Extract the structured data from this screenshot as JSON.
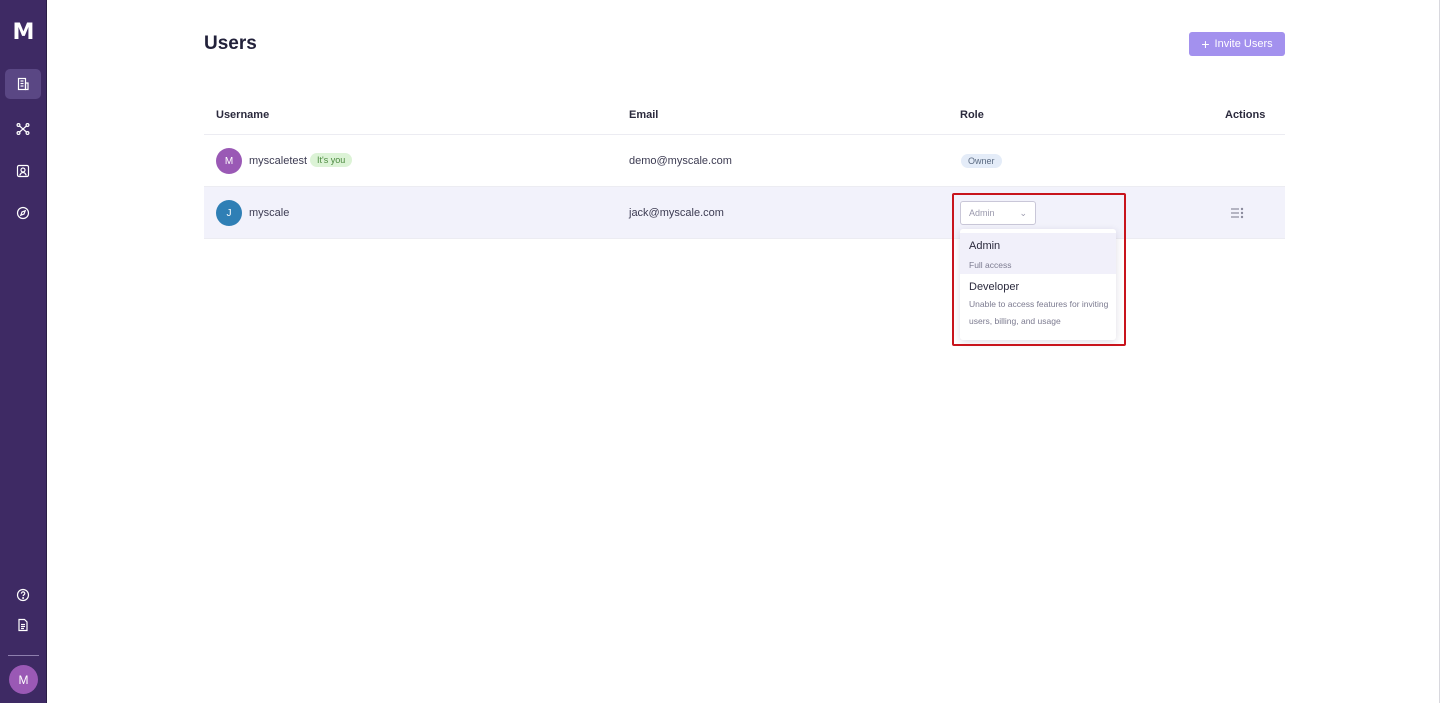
{
  "app": {
    "logo_text": "M"
  },
  "sidebar": {
    "nav": [
      {
        "icon": "building-icon",
        "active": true
      },
      {
        "icon": "network-icon",
        "active": false
      },
      {
        "icon": "contacts-icon",
        "active": false
      },
      {
        "icon": "compass-icon",
        "active": false
      }
    ],
    "bottom": [
      {
        "icon": "help-icon"
      },
      {
        "icon": "document-icon"
      }
    ],
    "user_avatar_initial": "M"
  },
  "header": {
    "title": "Users",
    "invite_button_label": "Invite Users"
  },
  "table": {
    "columns": {
      "username": "Username",
      "email": "Email",
      "role": "Role",
      "actions": "Actions"
    },
    "rows": [
      {
        "avatar_initial": "M",
        "avatar_color": "#9a59b5",
        "username": "myscaletest",
        "badge": "It's you",
        "email": "demo@myscale.com",
        "role": "Owner"
      },
      {
        "avatar_initial": "J",
        "avatar_color": "#2f7fb5",
        "username": "myscale",
        "email": "jack@myscale.com",
        "role": "Admin"
      }
    ]
  },
  "role_dropdown": {
    "selected": "Admin",
    "options": [
      {
        "title": "Admin",
        "description": "Full access"
      },
      {
        "title": "Developer",
        "description": "Unable to access features for inviting users, billing, and usage"
      }
    ]
  },
  "colors": {
    "sidebar_bg": "#3e2a64",
    "accent": "#a391ee",
    "highlight_border": "#c8141c"
  }
}
